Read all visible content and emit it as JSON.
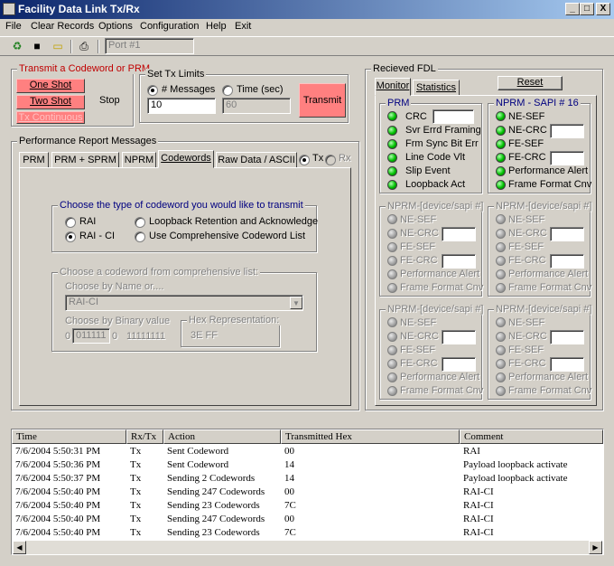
{
  "window": {
    "title": "Facility Data Link Tx/Rx",
    "min": "_",
    "max": "□",
    "close": "X"
  },
  "menu": [
    "File",
    "Clear Records",
    "Options",
    "Configuration",
    "Help",
    "Exit"
  ],
  "toolbar": {
    "port_placeholder": "Port #1"
  },
  "transmit": {
    "legend": "Transmit a Codeword or PRM",
    "one_shot": "One Shot",
    "two_shot": "Two Shot",
    "tx_cont": "Tx Continuous",
    "stop": "Stop"
  },
  "limits": {
    "legend": "Set Tx Limits",
    "messages": "# Messages",
    "time": "Time (sec)",
    "messages_value": "10",
    "time_value": "60",
    "transmit": "Transmit"
  },
  "perf": {
    "legend": "Performance Report  Messages",
    "tabs": [
      "PRM",
      "PRM + SPRM",
      "NPRM",
      "Codewords",
      "Raw Data / ASCII"
    ],
    "tx": "Tx",
    "rx": "Rx"
  },
  "codeword": {
    "type_legend": "Choose the type of codeword you would like to transmit",
    "rai": "RAI",
    "rai_ci": "RAI - CI",
    "loopback": "Loopback Retention and Acknowledge",
    "comprehensive": "Use Comprehensive Codeword List",
    "list_legend": "Choose a codeword from comprehensive list:",
    "by_name": "Choose by Name or....",
    "name_value": "RAI-CI",
    "by_binary": "Choose by Binary value",
    "bin_prefix": "0",
    "bin_value": "011111",
    "bin_mid": "0",
    "bin_suffix": "11111111",
    "hex_legend": "Hex Representation:",
    "hex_value": "3E  FF"
  },
  "received": {
    "legend": "Recieved FDL",
    "reset": "Reset",
    "tabs": [
      "Monitor",
      "Statistics"
    ],
    "prm": {
      "legend": "PRM",
      "items": [
        "CRC",
        "Svr Errd Framing",
        "Frm Sync Bit Err",
        "Line Code Vlt",
        "Slip Event",
        "Loopback Act"
      ]
    },
    "nprm16": {
      "legend": "NPRM - SAPI # 16",
      "items": [
        "NE-SEF",
        "NE-CRC",
        "FE-SEF",
        "FE-CRC",
        "Performance Alert",
        "Frame Format Cnv"
      ]
    },
    "nprm_generic": {
      "legend": "NPRM-[device/sapi #]",
      "items": [
        "NE-SEF",
        "NE-CRC",
        "FE-SEF",
        "FE-CRC",
        "Performance Alert",
        "Frame Format Cnv"
      ]
    }
  },
  "log": {
    "columns": [
      "Time",
      "Rx/Tx",
      "Action",
      "Transmitted Hex",
      "Comment"
    ],
    "rows": [
      [
        "7/6/2004 5:50:31 PM",
        "Tx",
        "Sent Codeword",
        "00",
        "RAI"
      ],
      [
        "7/6/2004 5:50:36 PM",
        "Tx",
        "Sent Codeword",
        "14",
        "Payload loopback activate"
      ],
      [
        "7/6/2004 5:50:37 PM",
        "Tx",
        "Sending 2 Codewords",
        "14",
        "Payload loopback activate"
      ],
      [
        "7/6/2004 5:50:40 PM",
        "Tx",
        "Sending 247 Codewords",
        "00",
        "RAI-CI"
      ],
      [
        "7/6/2004 5:50:40 PM",
        "Tx",
        "Sending 23 Codewords",
        "7C",
        "RAI-CI"
      ],
      [
        "7/6/2004 5:50:40 PM",
        "Tx",
        "Sending 247 Codewords",
        "00",
        "RAI-CI"
      ],
      [
        "7/6/2004 5:50:40 PM",
        "Tx",
        "Sending 23 Codewords",
        "7C",
        "RAI-CI"
      ]
    ]
  },
  "colors": {
    "title_start": "#0a246a",
    "title_end": "#a6caf0",
    "accent_red": "#ff8080",
    "led_green": "#00c000"
  }
}
